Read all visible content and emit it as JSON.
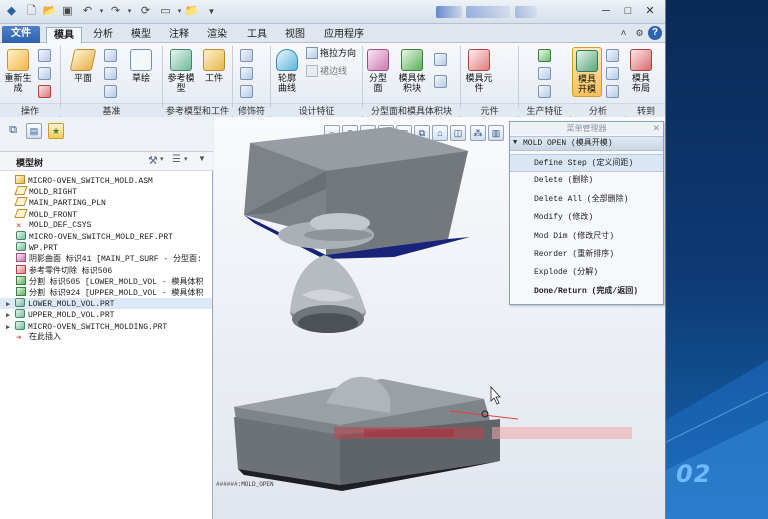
{
  "menu_tabs": [
    "文件",
    "模具",
    "分析",
    "模型",
    "注释",
    "渲染",
    "工具",
    "视图",
    "应用程序"
  ],
  "active_tab": "模具",
  "ribbon": {
    "buttons": {
      "regenerate": "重新生\n成",
      "plane": "平面",
      "sketch": "草绘",
      "ref_model": "参考模\n型",
      "workpiece": "工件",
      "silhouette": "轮廓\n曲线",
      "draw_direction": "拖拉方向",
      "skirt_curve": "裙边线",
      "parting_surface": "分型\n面",
      "mold_volume": "模具体\n积块",
      "mold_component": "模具元\n件",
      "mold_open": "模具\n开模",
      "mold_layout": "模具\n布局"
    },
    "groups": [
      "操作",
      "基准",
      "参考模型和工件",
      "修饰符",
      "设计特征",
      "分型面和模具体积块",
      "元件",
      "生产特征",
      "分析",
      "转到"
    ]
  },
  "sidebar": {
    "header": "模型树",
    "tree": [
      {
        "label": "MICRO-OVEN_SWITCH_MOLD.ASM",
        "icon": "assembly-icon",
        "indent": 0
      },
      {
        "label": "MOLD_RIGHT",
        "icon": "datum-plane-icon",
        "indent": 1
      },
      {
        "label": "MAIN_PARTING_PLN",
        "icon": "datum-plane-icon",
        "indent": 1
      },
      {
        "label": "MOLD_FRONT",
        "icon": "datum-plane-icon",
        "indent": 1
      },
      {
        "label": "MOLD_DEF_CSYS",
        "icon": "csys-icon",
        "indent": 1
      },
      {
        "label": "MICRO-OVEN_SWITCH_MOLD_REF.PRT",
        "icon": "part-icon",
        "indent": 1
      },
      {
        "label": "WP.PRT",
        "icon": "part-icon",
        "indent": 1
      },
      {
        "label": "阴影曲面 标识41 [MAIN_PT_SURF - 分型面:",
        "icon": "surface-icon",
        "indent": 1
      },
      {
        "label": "参考零件切除 标识506",
        "icon": "cut-icon",
        "indent": 1
      },
      {
        "label": "分割 标识505 [LOWER_MOLD_VOL - 模具体积",
        "icon": "split-icon",
        "indent": 1
      },
      {
        "label": "分割 标识924 [UPPER_MOLD_VOL - 模具体积",
        "icon": "split-icon",
        "indent": 1
      },
      {
        "label": "LOWER_MOLD_VOL.PRT",
        "icon": "part-icon",
        "indent": 0,
        "expand": true,
        "selected": true
      },
      {
        "label": "UPPER_MOLD_VOL.PRT",
        "icon": "part-icon",
        "indent": 0,
        "expand": true
      },
      {
        "label": "MICRO-OVEN_SWITCH_MOLDING.PRT",
        "icon": "part-icon",
        "indent": 0,
        "expand": true
      },
      {
        "label": "在此插入",
        "icon": "insert-arrow-icon",
        "indent": 1
      }
    ]
  },
  "menu_manager": {
    "title": "菜单管理器",
    "header": "MOLD OPEN (模具开模)",
    "items": [
      {
        "label": "Define Step (定义间距)",
        "selected": true
      },
      {
        "label": "Delete (删除)"
      },
      {
        "label": "Delete All (全部删除)"
      },
      {
        "label": "Modify (修改)"
      },
      {
        "label": "Mod Dim (修改尺寸)"
      },
      {
        "label": "Reorder (重新排序)"
      },
      {
        "label": "Explode (分解)"
      },
      {
        "label": "Done/Return (完成/返回)",
        "bold": true
      }
    ]
  },
  "viewport": {
    "caption": "######:MOLD_OPEN"
  },
  "desktop": {
    "number": "02"
  },
  "colors": {
    "mold_top": "#8a8f95",
    "mold_side": "#707479",
    "mold_dark": "#1a2a6c",
    "accent_blue": "#2e62ad"
  }
}
